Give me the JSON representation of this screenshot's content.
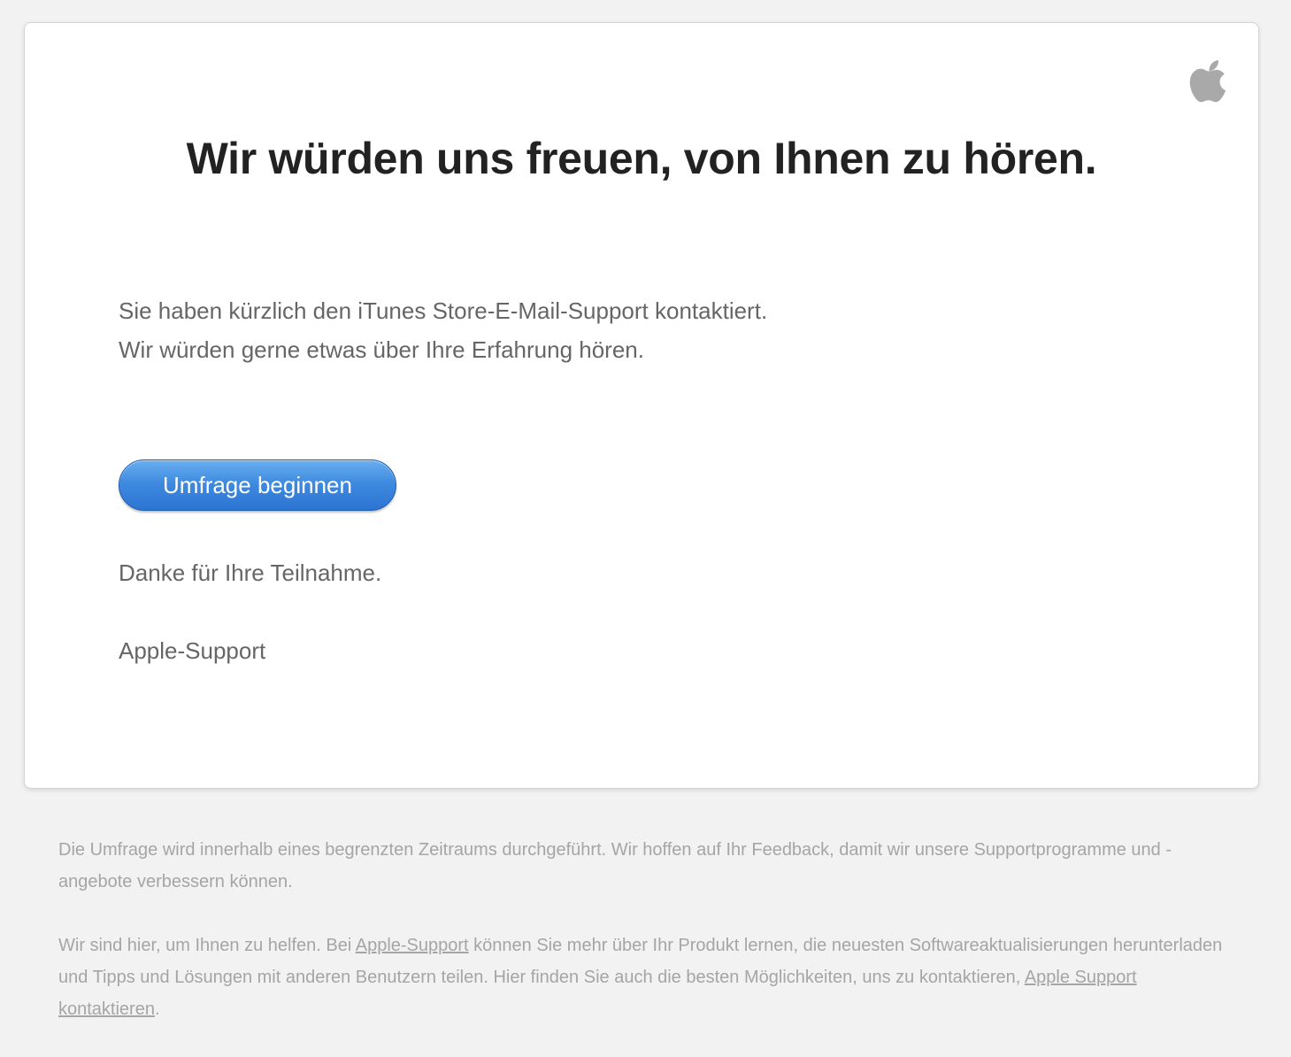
{
  "card": {
    "logo_icon": "apple-logo-icon",
    "headline": "Wir würden uns freuen, von Ihnen zu hören.",
    "intro_line_1": "Sie haben kürzlich den iTunes Store-E-Mail-Support kontaktiert.",
    "intro_line_2": "Wir würden gerne etwas über Ihre Erfahrung hören.",
    "cta_label": "Umfrage beginnen",
    "thanks": "Danke für Ihre Teilnahme.",
    "signature": "Apple-Support"
  },
  "footer": {
    "paragraph_1": "Die Umfrage wird innerhalb eines begrenzten Zeitraums durchgeführt. Wir hoffen auf Ihr Feedback, damit wir unsere Supportprogramme und -angebote verbessern können.",
    "p2_before_link": "Wir sind hier, um Ihnen zu helfen. Bei ",
    "p2_link_1": "Apple-Support",
    "p2_middle": " können Sie mehr über Ihr Produkt lernen, die neuesten Softwareaktualisierungen herunterladen und Tipps und Lösungen mit anderen Benutzern teilen. Hier finden Sie auch die besten Möglichkeiten, uns zu kontaktieren, ",
    "p2_link_2": "Apple Support kontaktieren",
    "p2_end": "."
  },
  "colors": {
    "background": "#f2f2f2",
    "card": "#ffffff",
    "headline": "#222222",
    "body_text": "#666666",
    "footer_text": "#a5a5a5",
    "button": "#3f8be0"
  }
}
